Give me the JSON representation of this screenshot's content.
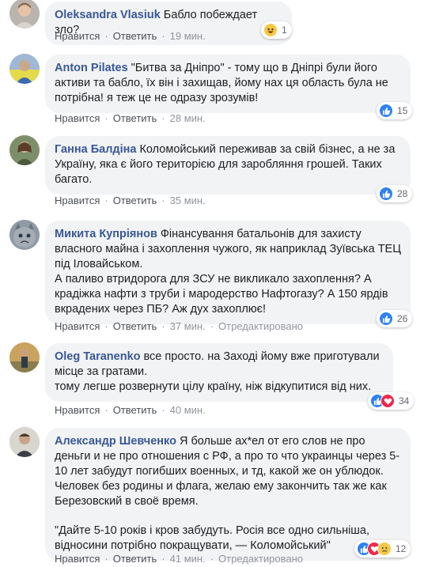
{
  "labels": {
    "like": "Нравится",
    "reply": "Ответить",
    "separator": "·",
    "edited": "Отредактировано"
  },
  "comments": [
    {
      "author": "Oleksandra Vlasiuk",
      "text": "Бабло побеждает зло?",
      "time": "19 мин.",
      "reactions": [
        "haha-icon"
      ],
      "reaction_count": "1"
    },
    {
      "author": "Anton Pilates",
      "text": "\"Битва за Дніпро\" - тому що в Дніпрі були його активи та бабло, їх він і захищав, йому нах ця область була не потрібна! я теж це не одразу зрозумів!",
      "time": "28 мин.",
      "reactions": [
        "like-icon"
      ],
      "reaction_count": "15"
    },
    {
      "author": "Ганна Балдіна",
      "text": "Коломойський переживав за свій бізнес, а не за Україну, яка є його територією для заробляння грошей. Таких багато.",
      "time": "35 мин.",
      "reactions": [
        "like-icon"
      ],
      "reaction_count": "28"
    },
    {
      "author": "Микита Купріянов",
      "text": "Фінансування батальонів для захисту власного майна і захоплення чужого, як наприклад Зуївська ТЕЦ під Іловайськом.\nА паливо втридорога для ЗСУ не викликало захоплення? А крадіжка нафти з труби і мародерство Нафтогазу? А 150 ярдів вкрадених через ПБ? Аж дух захоплює!",
      "time": "37 мин.",
      "edited": true,
      "reactions": [
        "like-icon"
      ],
      "reaction_count": "26"
    },
    {
      "author": "Oleg Taranenko",
      "text": "все просто. на Заході йому вже приготували місце за гратами.\nтому легше розвернути цілу країну, ніж відкупитися від них.",
      "time": "40 мин.",
      "reactions": [
        "like-icon",
        "love-icon"
      ],
      "reaction_count": "34"
    },
    {
      "author": "Александр Шевченко",
      "text": "Я больше ах*ел от его слов не про деньги и не про отношения с РФ, а про то что украинцы через 5-10 лет забудут погибших военных, и тд, какой же он ублюдок. Человек без родины и флага, желаю ему закончить так же как Березовский в своё время.",
      "quote": "\"Дайте 5-10 років і кров забудуть. Росія все одно сильніша, відносини потрібно покращувати, — Коломойський\"",
      "time": "41 мин.",
      "edited": true,
      "reactions": [
        "like-icon",
        "love-icon",
        "sad-icon"
      ],
      "reaction_count": "12"
    }
  ]
}
